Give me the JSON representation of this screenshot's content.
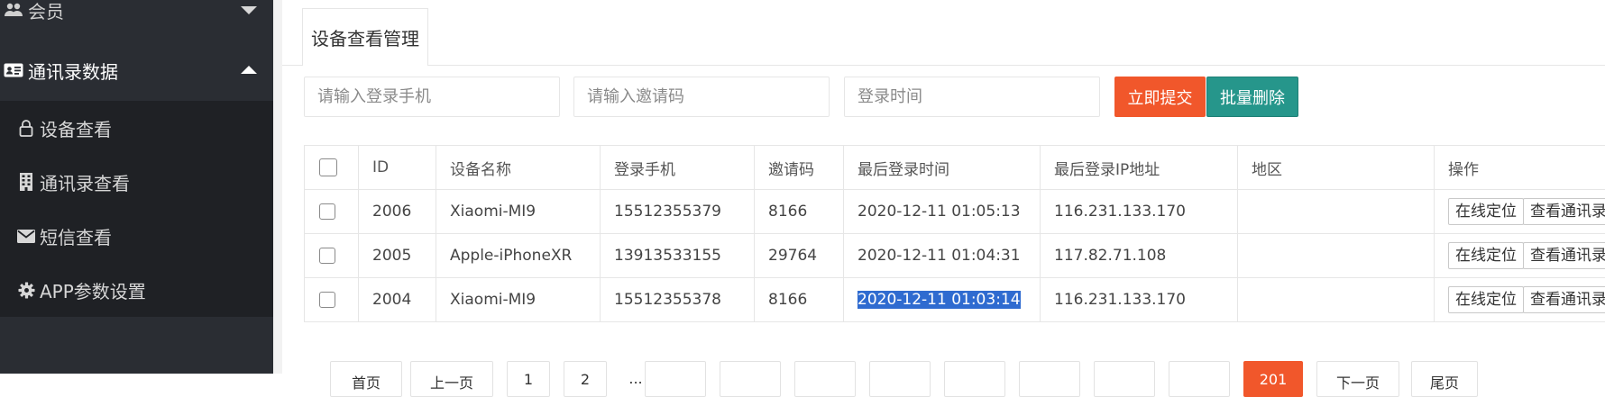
{
  "sidebar": {
    "member": {
      "label": "会员",
      "icon": "users-icon"
    },
    "contacts": {
      "label": "通讯录数据",
      "icon": "id-card-icon"
    },
    "items": [
      {
        "label": "设备查看",
        "icon": "lock-icon"
      },
      {
        "label": "通讯录查看",
        "icon": "building-icon"
      },
      {
        "label": "短信查看",
        "icon": "envelope-icon"
      },
      {
        "label": "APP参数设置",
        "icon": "gear-icon"
      }
    ]
  },
  "tab": {
    "title": "设备查看管理"
  },
  "filters": {
    "phone_placeholder": "请输入登录手机",
    "invite_placeholder": "请输入邀请码",
    "time_placeholder": "登录时间",
    "submit_label": "立即提交",
    "delete_label": "批量删除"
  },
  "table": {
    "columns": [
      "ID",
      "设备名称",
      "登录手机",
      "邀请码",
      "最后登录时间",
      "最后登录IP地址",
      "地区",
      "操作"
    ],
    "rows": [
      {
        "id": "2006",
        "device": "Xiaomi-MI9",
        "phone": "15512355379",
        "invite": "8166",
        "time": "2020-12-11 01:05:13",
        "ip": "116.231.133.170",
        "region": "",
        "actions": [
          "在线定位",
          "查看通讯录"
        ]
      },
      {
        "id": "2005",
        "device": "Apple-iPhoneXR",
        "phone": "13913533155",
        "invite": "29764",
        "time": "2020-12-11 01:04:31",
        "ip": "117.82.71.108",
        "region": "",
        "actions": [
          "在线定位",
          "查看通讯录"
        ]
      },
      {
        "id": "2004",
        "device": "Xiaomi-MI9",
        "phone": "15512355378",
        "invite": "8166",
        "time": "2020-12-11 01:03:14",
        "ip": "116.231.133.170",
        "region": "",
        "actions": [
          "在线定位",
          "查看通讯录"
        ]
      }
    ]
  },
  "pagination": {
    "items": [
      {
        "label": "首页",
        "active": false
      },
      {
        "label": "上一页",
        "active": false
      },
      {
        "label": "1",
        "active": false
      },
      {
        "label": "2",
        "active": false
      },
      {
        "label": "...",
        "active": false
      },
      {
        "label": "",
        "active": false
      },
      {
        "label": "",
        "active": false
      },
      {
        "label": "",
        "active": false
      },
      {
        "label": "",
        "active": false
      },
      {
        "label": "",
        "active": false
      },
      {
        "label": "",
        "active": false
      },
      {
        "label": "",
        "active": false
      },
      {
        "label": "",
        "active": false
      },
      {
        "label": "201",
        "active": true
      },
      {
        "label": "下一页",
        "active": false
      },
      {
        "label": "尾页",
        "active": false
      }
    ]
  },
  "colors": {
    "accent": "#f1572b",
    "delete": "#26968b",
    "sidebar": "#2a2d33",
    "submenu": "#1f2125",
    "selection": "#2f6bd0"
  }
}
